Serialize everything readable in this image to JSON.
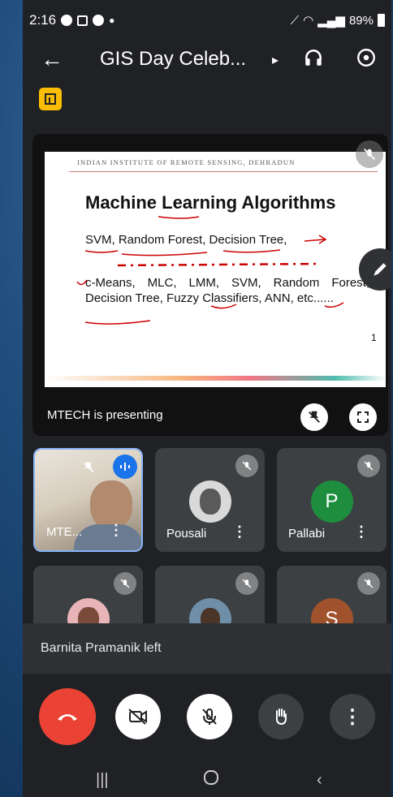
{
  "status_bar": {
    "time": "2:16",
    "battery": "89%"
  },
  "header": {
    "title": "GIS Day Celeb...",
    "caret": "▸"
  },
  "slide": {
    "institute": "INDIAN INSTITUTE OF REMOTE SENSING, DEHRADUN",
    "heading": "Machine Learning Algorithms",
    "line1": "SVM, Random Forest, Decision Tree,",
    "line2": "c-Means, MLC, LMM, SVM, Random Forest, Decision Tree, Fuzzy Classifiers, ANN, etc......",
    "page_number": "1"
  },
  "presentation": {
    "label": "MTECH is presenting"
  },
  "participants": [
    {
      "name": "MTE...",
      "initial": ""
    },
    {
      "name": "Pousali",
      "initial": ""
    },
    {
      "name": "Pallabi",
      "initial": "P",
      "color": "#1e8e3e"
    },
    {
      "name": "",
      "initial": ""
    },
    {
      "name": "",
      "initial": ""
    },
    {
      "name": "",
      "initial": "S",
      "color": "#a0522d"
    }
  ],
  "toast": {
    "message": "Barnita Pramanik left"
  },
  "controls": {
    "end_call_color": "#ea4335"
  }
}
